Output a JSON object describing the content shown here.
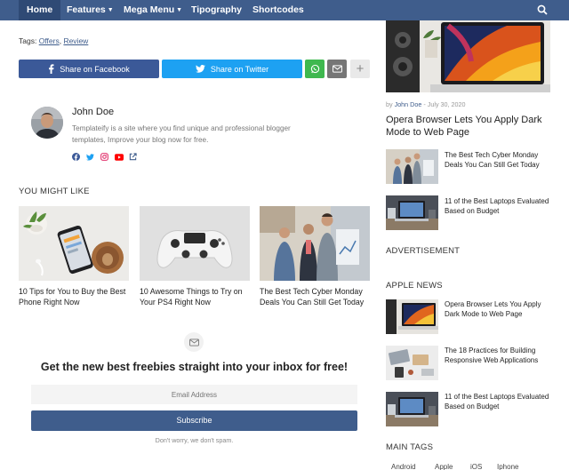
{
  "nav": {
    "items": [
      {
        "label": "Home",
        "caret": false
      },
      {
        "label": "Features",
        "caret": true
      },
      {
        "label": "Mega Menu",
        "caret": true
      },
      {
        "label": "Tipography",
        "caret": false
      },
      {
        "label": "Shortcodes",
        "caret": false
      }
    ],
    "search_icon": "search-icon"
  },
  "post": {
    "tags_label": "Tags:",
    "tags": [
      "Offers",
      "Review"
    ],
    "share": {
      "facebook": "Share on Facebook",
      "twitter": "Share on Twitter",
      "more": "+"
    }
  },
  "author": {
    "name": "John Doe",
    "bio": "Templateify is a site where you find unique and professional blogger templates, Improve your blog now for free.",
    "social": [
      "facebook-icon",
      "twitter-icon",
      "instagram-icon",
      "youtube-icon",
      "external-link-icon"
    ]
  },
  "related": {
    "title": "YOU MIGHT LIKE",
    "items": [
      {
        "title": "10 Tips for You to Buy the Best Phone Right Now"
      },
      {
        "title": "10 Awesome Things to Try on Your PS4 Right Now"
      },
      {
        "title": "The Best Tech Cyber Monday Deals You Can Still Get Today"
      }
    ]
  },
  "newsletter": {
    "title": "Get the new best freebies straight into your inbox for free!",
    "placeholder": "Email Address",
    "button": "Subscribe",
    "note": "Don't worry, we don't spam."
  },
  "sidebar": {
    "hero": {
      "by": "by",
      "author": "John Doe",
      "date": "- July 30, 2020",
      "title": "Opera Browser Lets You Apply Dark Mode to Web Page"
    },
    "list1": [
      {
        "title": "The Best Tech Cyber Monday Deals You Can Still Get Today"
      },
      {
        "title": "11 of the Best Laptops Evaluated Based on Budget"
      }
    ],
    "advertisement_title": "ADVERTISEMENT",
    "apple_news_title": "APPLE NEWS",
    "apple_news": [
      {
        "title": "Opera Browser Lets You Apply Dark Mode to Web Page"
      },
      {
        "title": "The 18 Practices for Building Responsive Web Applications"
      },
      {
        "title": "11 of the Best Laptops Evaluated Based on Budget"
      }
    ],
    "main_tags_title": "MAIN TAGS",
    "main_tags": [
      "Android",
      "Apple",
      "iOS",
      "Iphone"
    ]
  },
  "colors": {
    "nav": "#3f5d8c",
    "facebook": "#3b5998",
    "twitter": "#1da1f2",
    "whatsapp": "#3fb84f"
  }
}
